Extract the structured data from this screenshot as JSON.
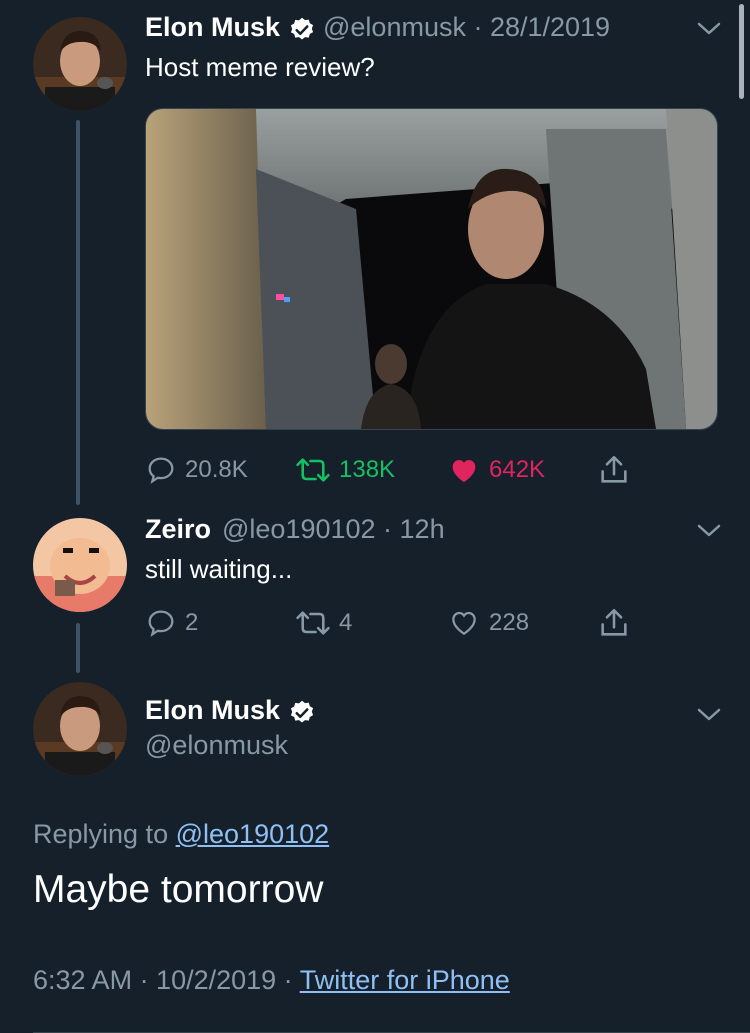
{
  "tweet1": {
    "name": "Elon Musk",
    "handle_time": "@elonmusk · 28/1/2019",
    "text": "Host meme review?",
    "replies": "20.8K",
    "retweets": "138K",
    "likes": "642K"
  },
  "tweet2": {
    "name": "Zeiro",
    "handle_time": "@leo190102 · 12h",
    "text": "still waiting...",
    "replies": "2",
    "retweets": "4",
    "likes": "228"
  },
  "tweet3": {
    "name": "Elon Musk",
    "handle": "@elonmusk",
    "replying_prefix": "Replying to",
    "replying_handle": "@leo190102",
    "text": "Maybe tomorrow",
    "time": "6:32 AM · 10/2/2019 · ",
    "source": "Twitter for iPhone"
  },
  "colors": {
    "background": "#15202b",
    "muted": "#8899a6",
    "retweet_green": "#17bf63",
    "like_pink": "#e0245e",
    "link": "#8ec0f5"
  },
  "icons": [
    "reply-icon",
    "retweet-icon",
    "heart-icon",
    "share-icon",
    "verified-badge-icon",
    "chevron-down-icon"
  ]
}
